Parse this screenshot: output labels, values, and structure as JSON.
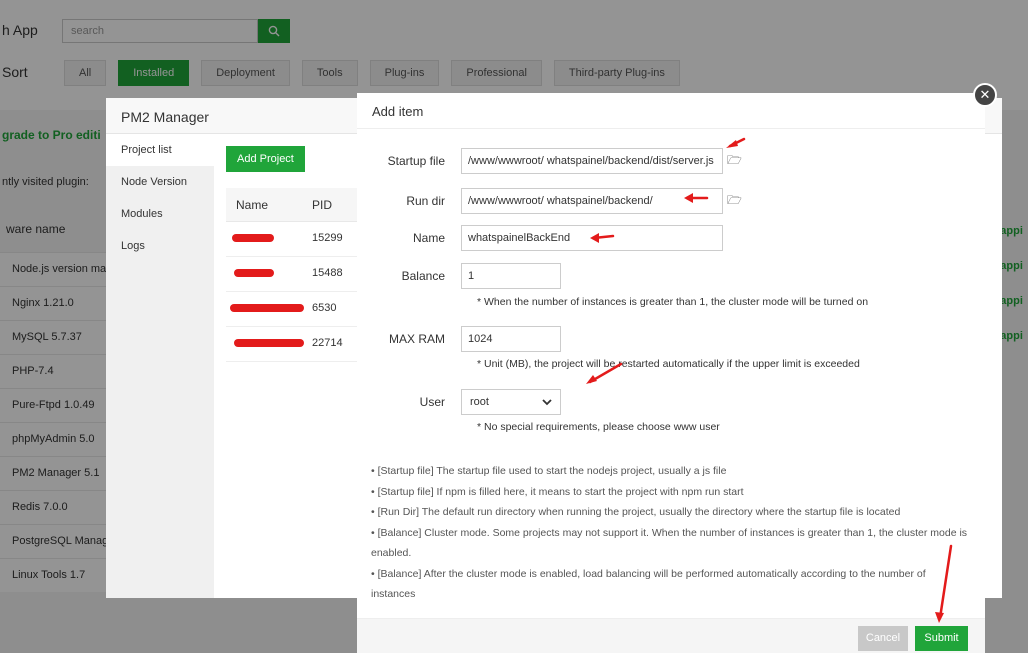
{
  "app": {
    "title": "h App",
    "search_placeholder": "search"
  },
  "sort": {
    "label": "Sort",
    "tabs": [
      "All",
      "Installed",
      "Deployment",
      "Tools",
      "Plug-ins",
      "Professional",
      "Third-party Plug-ins"
    ],
    "active": "Installed"
  },
  "sidebar": {
    "upgrade": "grade to Pro editi",
    "recent": "ntly visited plugin:",
    "header": "ware name",
    "items": [
      "Node.js version ma",
      "Nginx 1.21.0",
      "MySQL 5.7.37",
      "PHP-7.4",
      "Pure-Ftpd 1.0.49",
      "phpMyAdmin 5.0",
      "PM2 Manager 5.1",
      "Redis 7.0.0",
      "PostgreSQL Manag",
      "Linux Tools 1.7"
    ]
  },
  "mapping": [
    "| Mappi",
    "| Mappi",
    "| Mappi",
    "| Mappi"
  ],
  "pm2": {
    "title": "PM2 Manager",
    "nav": [
      "Project list",
      "Node Version",
      "Modules",
      "Logs"
    ],
    "add_project": "Add Project",
    "columns": [
      "Name",
      "PID"
    ],
    "rows": [
      {
        "pid": "15299"
      },
      {
        "pid": "15488"
      },
      {
        "pid": "6530"
      },
      {
        "pid": "22714"
      }
    ]
  },
  "add_item": {
    "title": "Add item",
    "startup_file": {
      "label": "Startup file",
      "value": "/www/wwwroot/ whatspainel/backend/dist/server.js"
    },
    "run_dir": {
      "label": "Run dir",
      "value": "/www/wwwroot/ whatspainel/backend/"
    },
    "name": {
      "label": "Name",
      "value": "whatspainelBackEnd"
    },
    "balance": {
      "label": "Balance",
      "value": "1",
      "hint": "* When the number of instances is greater than 1, the cluster mode will be turned on"
    },
    "max_ram": {
      "label": "MAX RAM",
      "value": "1024",
      "hint": "* Unit (MB), the project will be restarted automatically if the upper limit is exceeded"
    },
    "user": {
      "label": "User",
      "value": "root",
      "hint": "* No special requirements, please choose www user"
    },
    "notes": [
      "•  [Startup file] The startup file used to start the nodejs project, usually a js file",
      "•  [Startup file] If npm is filled here, it means to start the project with npm run start",
      "•  [Run Dir] The default run directory when running the project, usually the directory where the startup file is located",
      "•  [Balance] Cluster mode. Some projects may not support it. When the number of instances is greater than 1, the cluster mode is enabled.",
      "•  [Balance] After the cluster mode is enabled, load balancing will be performed automatically according to the number of instances"
    ],
    "cancel": "Cancel",
    "submit": "Submit"
  },
  "colors": {
    "green": "#20a53a",
    "annotation_red": "#e31b1b"
  }
}
